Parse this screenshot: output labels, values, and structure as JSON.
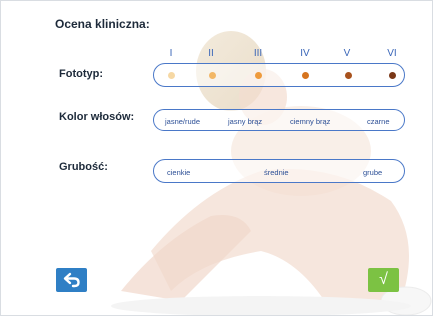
{
  "header": {
    "title": "Ocena kliniczna:"
  },
  "fototyp": {
    "label": "Fototyp:",
    "numerals": [
      "I",
      "II",
      "III",
      "IV",
      "V",
      "VI"
    ],
    "dot_colors": [
      "#f6d8a4",
      "#f2b766",
      "#ee9a3c",
      "#d6741e",
      "#a8521d",
      "#7a3717"
    ]
  },
  "kolor": {
    "label": "Kolor włosów:",
    "options": [
      "jasne/rude",
      "jasny brąz",
      "ciemny brąz",
      "czarne"
    ]
  },
  "grubosc": {
    "label": "Grubość:",
    "options": [
      "cienkie",
      "średnie",
      "grube"
    ]
  },
  "buttons": {
    "back_icon": "back-arrow-icon",
    "confirm_icon": "checkmark-icon",
    "confirm_glyph": "√",
    "back_color": "#2f7fc5",
    "confirm_color": "#7cc243"
  }
}
